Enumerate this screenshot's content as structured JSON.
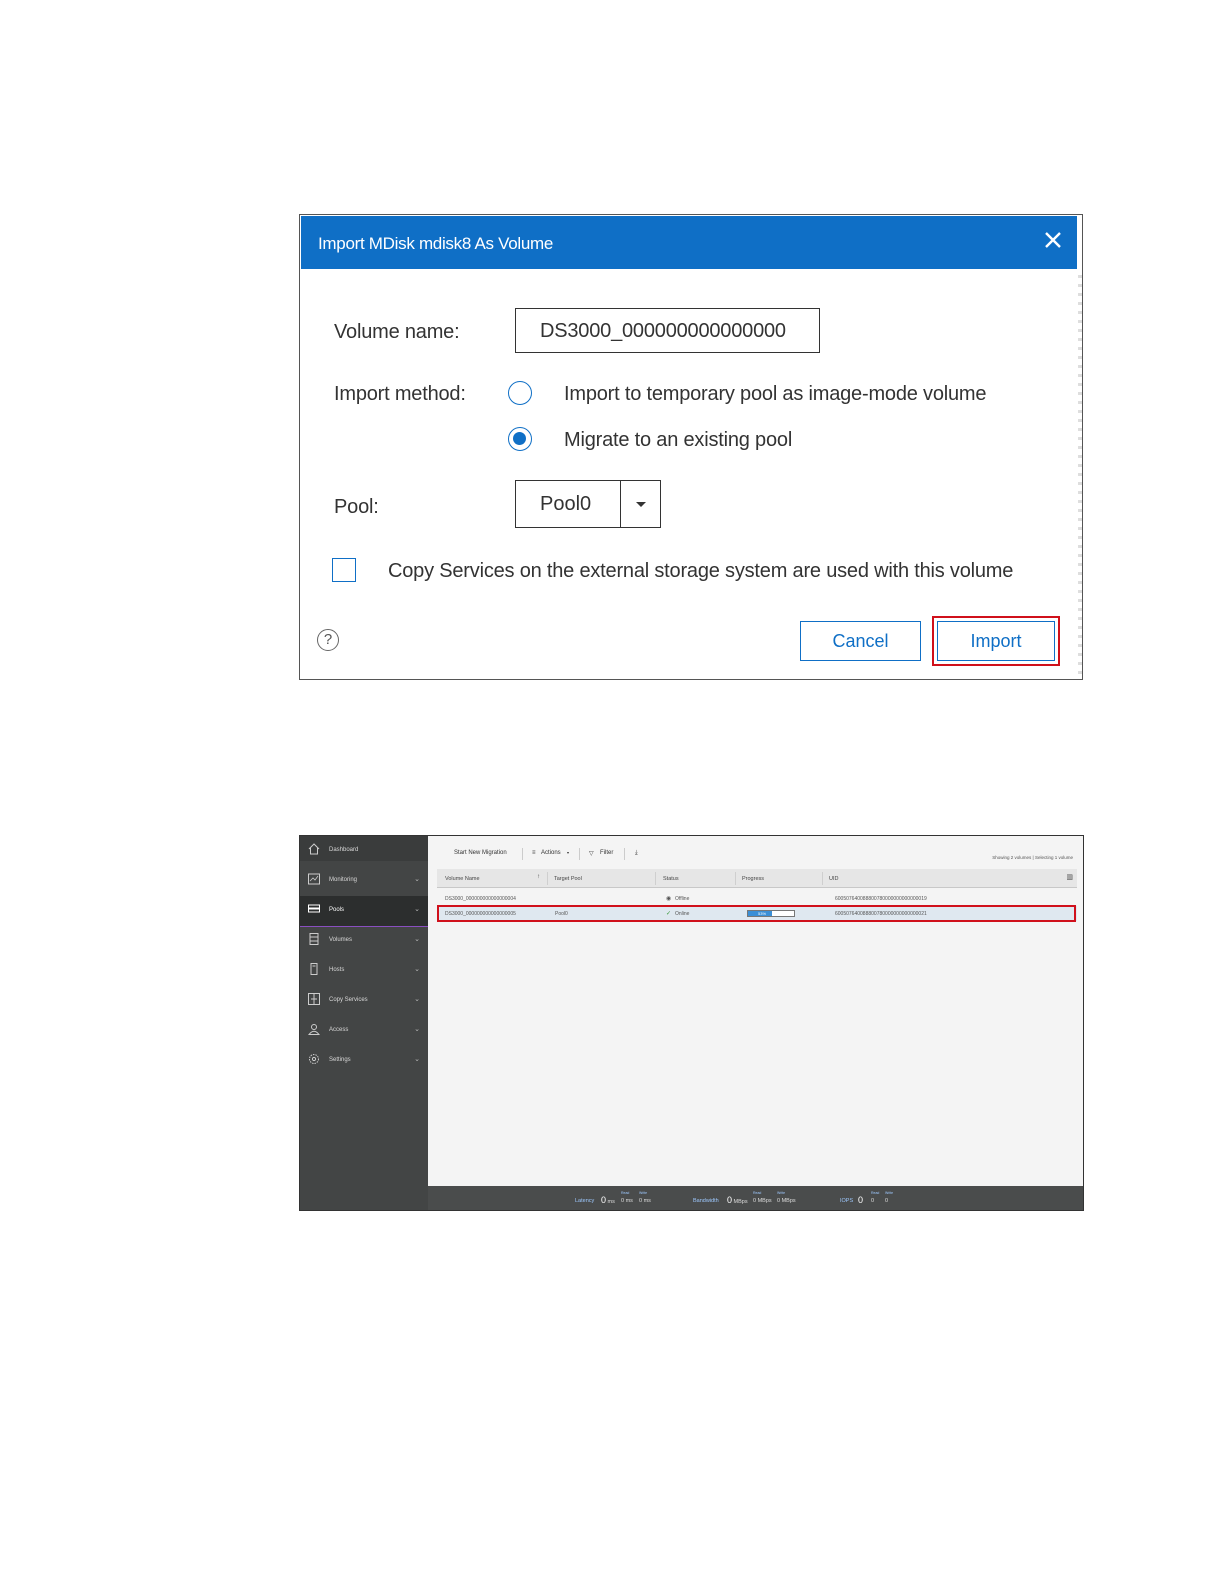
{
  "dialog": {
    "title": "Import MDisk mdisk8 As Volume",
    "volume_name_label": "Volume name:",
    "volume_name_value": "DS3000_000000000000000",
    "import_method_label": "Import method:",
    "option_temp_pool": "Import to temporary pool as image-mode volume",
    "option_existing_pool": "Migrate to an existing pool",
    "selected_option": "Migrate to an existing pool",
    "pool_label": "Pool:",
    "pool_value": "Pool0",
    "copy_services_label": "Copy Services on the external storage system are used with this volume",
    "copy_services_checked": false,
    "help_glyph": "?",
    "cancel_label": "Cancel",
    "import_label": "Import",
    "accent_color": "#0f6fc6",
    "highlight_color": "#d0101b"
  },
  "migration": {
    "sidebar": [
      {
        "label": "Dashboard",
        "icon": "home-icon"
      },
      {
        "label": "Monitoring",
        "icon": "monitoring-icon"
      },
      {
        "label": "Pools",
        "icon": "pools-icon",
        "active": true
      },
      {
        "label": "Volumes",
        "icon": "volumes-icon"
      },
      {
        "label": "Hosts",
        "icon": "hosts-icon"
      },
      {
        "label": "Copy Services",
        "icon": "copy-services-icon"
      },
      {
        "label": "Access",
        "icon": "access-icon"
      },
      {
        "label": "Settings",
        "icon": "settings-icon"
      }
    ],
    "toolbar": {
      "start_new_migration": "Start New Migration",
      "actions": "Actions",
      "filter": "Filter",
      "showing": "Showing 2 volumes | Selecting 1 volume"
    },
    "columns": [
      "Volume Name",
      "Target Pool",
      "Status",
      "Progress",
      "UID"
    ],
    "rows": [
      {
        "volume_name": "DS3000_000000000000000004",
        "target_pool": "",
        "status": "Offline",
        "progress": null,
        "uid": "600507640088800780000000000000019"
      },
      {
        "volume_name": "DS3000_000000000000000005",
        "target_pool": "Pool0",
        "status": "Online",
        "progress": "53%",
        "progress_fraction": 0.53,
        "uid": "600507640088800780000000000000021"
      }
    ],
    "statusbar": {
      "latency_label": "Latency",
      "latency_value": "0",
      "latency_unit": "ms",
      "latency_read_label": "Read",
      "latency_read": "0 ms",
      "latency_write_label": "Write",
      "latency_write": "0 ms",
      "bandwidth_label": "Bandwidth",
      "bandwidth_value": "0",
      "bandwidth_unit": "MBps",
      "bandwidth_read_label": "Read",
      "bandwidth_read": "0 MBps",
      "bandwidth_write_label": "Write",
      "bandwidth_write": "0 MBps",
      "iops_label": "IOPS",
      "iops_value": "0",
      "iops_read_label": "Read",
      "iops_read": "0",
      "iops_write_label": "Write",
      "iops_write": "0"
    }
  }
}
